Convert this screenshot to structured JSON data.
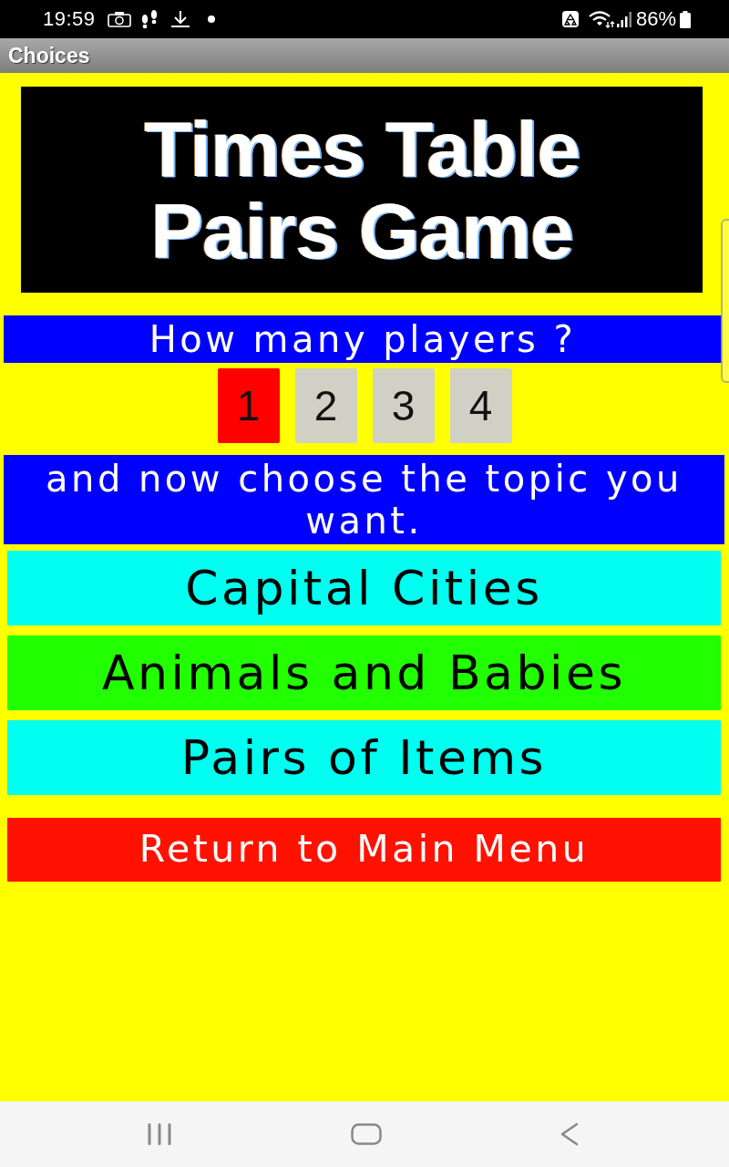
{
  "status_bar": {
    "time": "19:59",
    "battery": "86%"
  },
  "title_bar": {
    "title": "Choices"
  },
  "banner": {
    "lines": [
      "Times Table",
      "Pairs Game"
    ]
  },
  "players": {
    "prompt": "How many players ?",
    "options": [
      {
        "label": "1",
        "selected": true
      },
      {
        "label": "2",
        "selected": false
      },
      {
        "label": "3",
        "selected": false
      },
      {
        "label": "4",
        "selected": false
      }
    ]
  },
  "topics": {
    "prompt": "and now choose the topic you want.",
    "items": [
      {
        "label": "Capital Cities",
        "color": "#00fff0"
      },
      {
        "label": "Animals and Babies",
        "color": "#22ff00"
      },
      {
        "label": "Pairs of Items",
        "color": "#00fff0"
      }
    ]
  },
  "return_button": {
    "label": "Return to Main Menu"
  }
}
